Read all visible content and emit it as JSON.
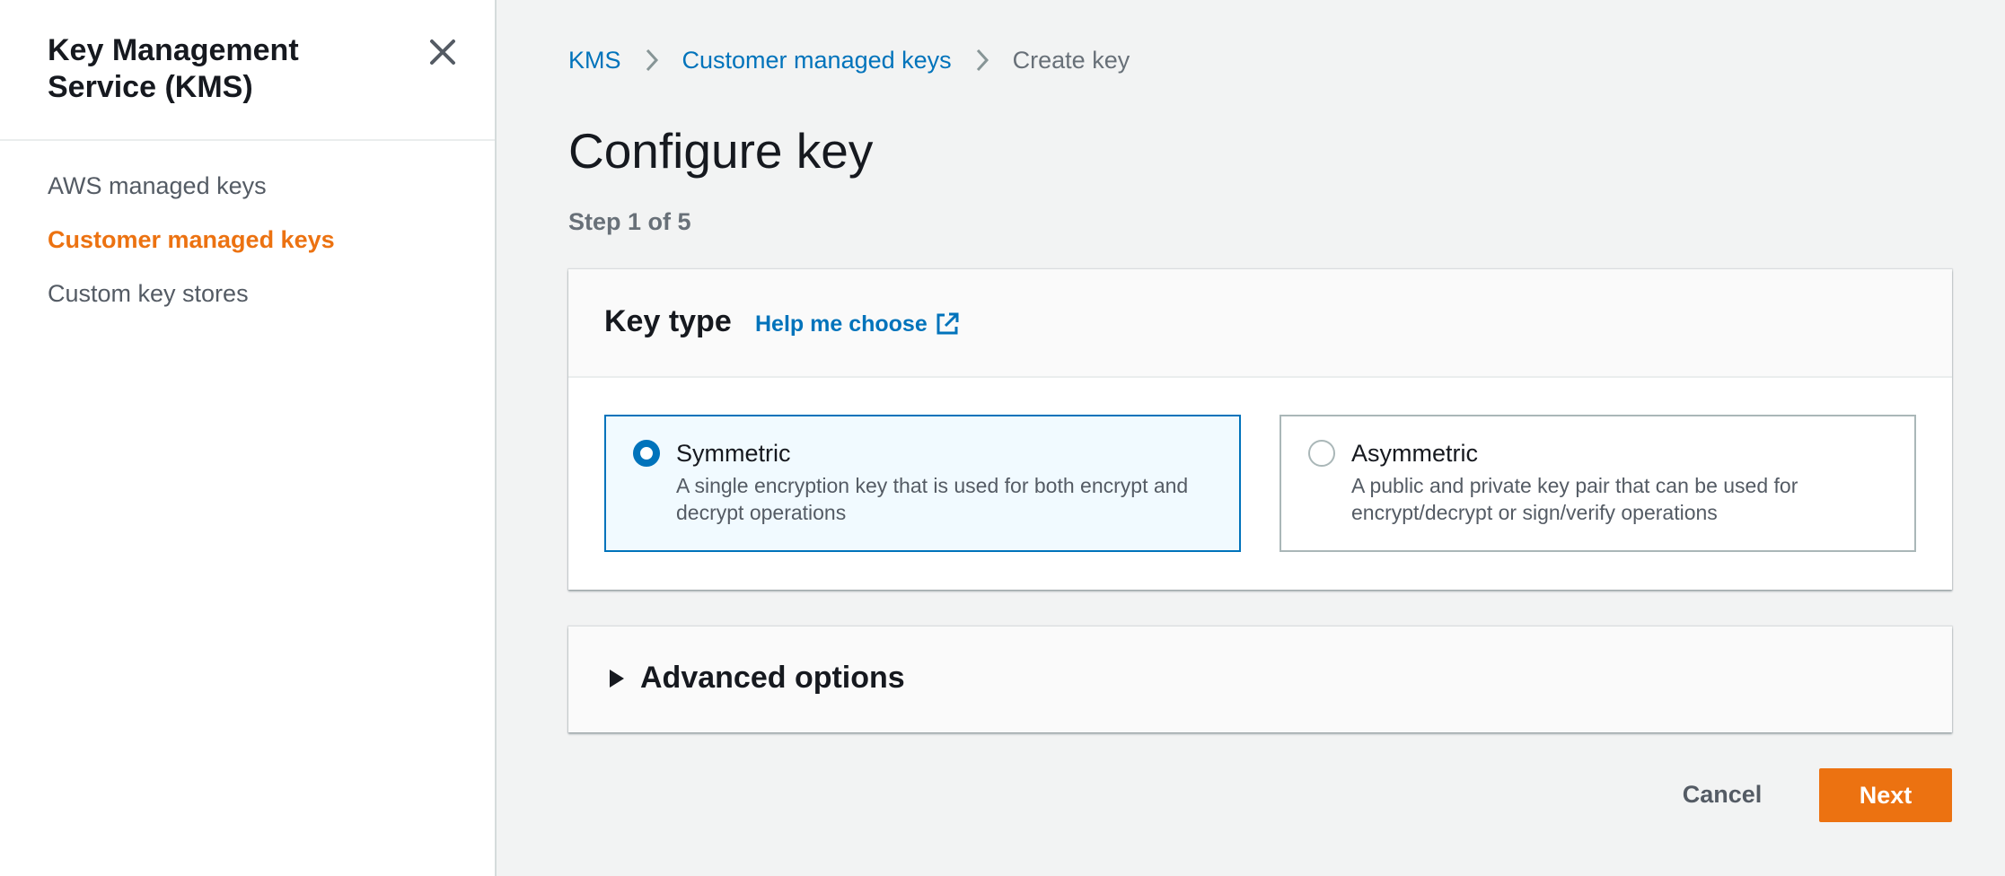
{
  "sidebar": {
    "title": "Key Management Service (KMS)",
    "items": [
      {
        "label": "AWS managed keys",
        "active": false
      },
      {
        "label": "Customer managed keys",
        "active": true
      },
      {
        "label": "Custom key stores",
        "active": false
      }
    ]
  },
  "breadcrumb": {
    "items": [
      "KMS",
      "Customer managed keys"
    ],
    "current": "Create key"
  },
  "page": {
    "title": "Configure key",
    "step": "Step 1 of 5"
  },
  "key_type_panel": {
    "title": "Key type",
    "help_link": "Help me choose",
    "options": [
      {
        "label": "Symmetric",
        "description": "A single encryption key that is used for both encrypt and decrypt operations",
        "selected": true
      },
      {
        "label": "Asymmetric",
        "description": "A public and private key pair that can be used for encrypt/decrypt or sign/verify operations",
        "selected": false
      }
    ]
  },
  "advanced": {
    "title": "Advanced options"
  },
  "footer": {
    "cancel_label": "Cancel",
    "next_label": "Next"
  },
  "colors": {
    "accent": "#ec7211",
    "link": "#0073bb",
    "selected_tile_bg": "#f1faff"
  },
  "icons": {
    "close": "close-icon",
    "breadcrumb_separator": "chevron-right-icon",
    "external_link": "external-link-icon",
    "expand": "caret-right-icon"
  }
}
